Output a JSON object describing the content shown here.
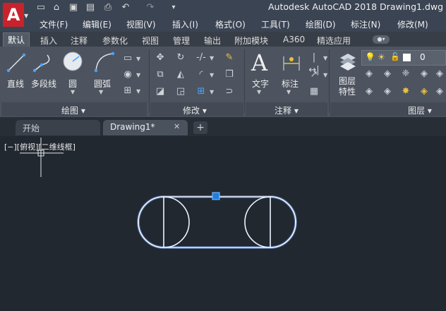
{
  "app": {
    "logo_letter": "A",
    "title": "Autodesk AutoCAD 2018    Drawing1.dwg"
  },
  "quick_access": [
    "new-icon",
    "open-icon",
    "save-icon",
    "saveas-icon",
    "print-icon",
    "undo-icon",
    "redo-icon",
    "customize-icon"
  ],
  "menu": [
    "文件(F)",
    "编辑(E)",
    "视图(V)",
    "插入(I)",
    "格式(O)",
    "工具(T)",
    "绘图(D)",
    "标注(N)",
    "修改(M)"
  ],
  "ribbon_tabs": [
    "默认",
    "插入",
    "注释",
    "参数化",
    "视图",
    "管理",
    "输出",
    "附加模块",
    "A360",
    "精选应用"
  ],
  "panels": {
    "draw": {
      "title": "绘图",
      "tools": [
        "直线",
        "多段线",
        "圆",
        "圆弧"
      ]
    },
    "modify": {
      "title": "修改"
    },
    "annotation": {
      "title": "注释",
      "tools": [
        "文字",
        "标注"
      ]
    },
    "layers": {
      "title": "图层",
      "tool": "图层\n特性",
      "tool_line1": "图层",
      "tool_line2": "特性",
      "current_layer": "0"
    }
  },
  "file_tabs": {
    "start": "开始",
    "drawing": "Drawing1*"
  },
  "viewport": {
    "label": "[−][俯视][二维线框]"
  },
  "colors": {
    "background": "#212830",
    "ribbon": "#4d5460",
    "accent_red": "#c8232c",
    "geometry": "#dfe8ff",
    "grip": "#1d7fe0"
  }
}
